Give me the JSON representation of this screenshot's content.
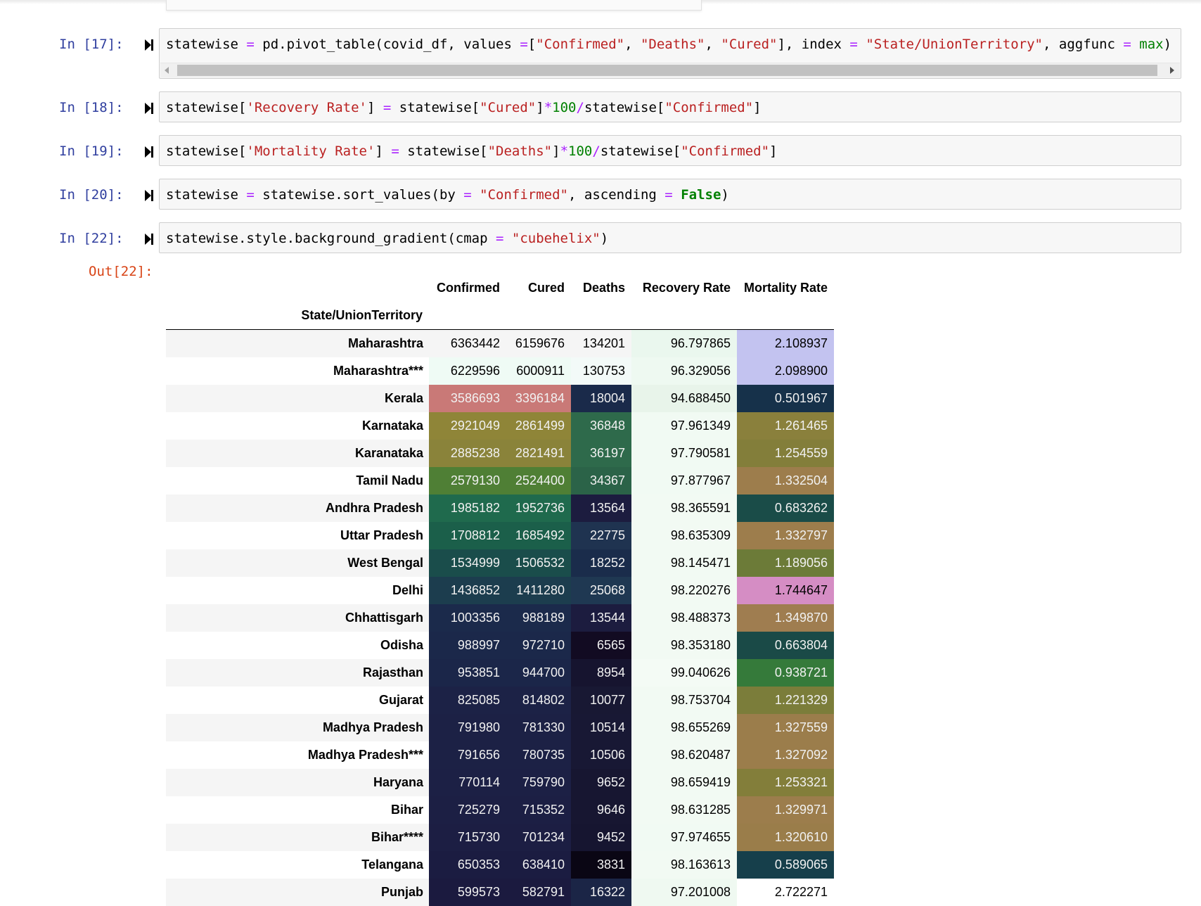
{
  "cells": [
    {
      "prompt": "In [17]:",
      "code_html": "statewise <span class=\"kw-op\">=</span> pd.pivot_table(covid_df, values <span class=\"kw-op\">=</span>[<span class=\"kw-str\">\"Confirmed\"</span>, <span class=\"kw-str\">\"Deaths\"</span>, <span class=\"kw-str\">\"Cured\"</span>], index <span class=\"kw-op\">=</span> <span class=\"kw-str\">\"State/UnionTerritory\"</span>, aggfunc <span class=\"kw-op\">=</span> <span class=\"kw-num\">max</span>)"
    },
    {
      "prompt": "In [18]:",
      "code_html": "statewise[<span class=\"kw-str\">'Recovery Rate'</span>] <span class=\"kw-op\">=</span> statewise[<span class=\"kw-str\">\"Cured\"</span>]<span class=\"kw-op\">*</span><span class=\"kw-num\">100</span><span class=\"kw-op\">/</span>statewise[<span class=\"kw-str\">\"Confirmed\"</span>]"
    },
    {
      "prompt": "In [19]:",
      "code_html": "statewise[<span class=\"kw-str\">'Mortality Rate'</span>] <span class=\"kw-op\">=</span> statewise[<span class=\"kw-str\">\"Deaths\"</span>]<span class=\"kw-op\">*</span><span class=\"kw-num\">100</span><span class=\"kw-op\">/</span>statewise[<span class=\"kw-str\">\"Confirmed\"</span>]"
    },
    {
      "prompt": "In [20]:",
      "code_html": "statewise <span class=\"kw-op\">=</span> statewise.sort_values(by <span class=\"kw-op\">=</span> <span class=\"kw-str\">\"Confirmed\"</span>, ascending <span class=\"kw-op\">=</span> <span class=\"kw-bool\">False</span>)"
    },
    {
      "prompt": "In [22]:",
      "code_html": "statewise.style.background_gradient(cmap <span class=\"kw-op\">=</span> <span class=\"kw-str\">\"cubehelix\"</span>)"
    }
  ],
  "output": {
    "prompt": "Out[22]:",
    "index_name": "State/UnionTerritory",
    "columns": [
      "Confirmed",
      "Cured",
      "Deaths",
      "Recovery Rate",
      "Mortality Rate"
    ],
    "rows": [
      {
        "state": "Maharashtra",
        "values": [
          "6363442",
          "6159676",
          "134201",
          "96.797865",
          "2.108937"
        ],
        "bg": [
          "#f5f5f5",
          "#f5f5f5",
          "#f5f5f5",
          "#eaf7ee",
          "#c3c3f0"
        ]
      },
      {
        "state": "Maharashtra***",
        "values": [
          "6229596",
          "6000911",
          "130753",
          "96.329056",
          "2.098900"
        ],
        "bg": [
          "#effbf5",
          "#effbf5",
          "#f3faf8",
          "#eef9f1",
          "#c3c3f0"
        ]
      },
      {
        "state": "Kerala",
        "values": [
          "3586693",
          "3396184",
          "18004",
          "94.688450",
          "0.501967"
        ],
        "bg": [
          "#c97977",
          "#c97977",
          "#1a2a4a",
          "#e8f4ea",
          "#16314a"
        ]
      },
      {
        "state": "Karnataka",
        "values": [
          "2921049",
          "2861499",
          "36848",
          "97.961349",
          "1.261465"
        ],
        "bg": [
          "#8f8538",
          "#8f8538",
          "#2e6a4b",
          "#f1faf3",
          "#8a803c"
        ]
      },
      {
        "state": "Karanataka",
        "values": [
          "2885238",
          "2821491",
          "36197",
          "97.790581",
          "1.254559"
        ],
        "bg": [
          "#8a833a",
          "#8a833a",
          "#2e6a4b",
          "#f1faf3",
          "#837e3a"
        ]
      },
      {
        "state": "Tamil Nadu",
        "values": [
          "2579130",
          "2524400",
          "34367",
          "97.877967",
          "1.332504"
        ],
        "bg": [
          "#4f7f35",
          "#4f7f35",
          "#2b6348",
          "#f1faf3",
          "#9d7d4c"
        ]
      },
      {
        "state": "Andhra Pradesh",
        "values": [
          "1985182",
          "1952736",
          "13564",
          "98.365591",
          "0.683262"
        ],
        "bg": [
          "#1f6a4d",
          "#1f6a4d",
          "#1c1c3f",
          "#f2faf3",
          "#1a4c48"
        ]
      },
      {
        "state": "Uttar Pradesh",
        "values": [
          "1708812",
          "1685492",
          "22775",
          "98.635309",
          "1.332797"
        ],
        "bg": [
          "#1b5f4a",
          "#1b5f4a",
          "#1f3350",
          "#f2faf3",
          "#9d7d4c"
        ]
      },
      {
        "state": "West Bengal",
        "values": [
          "1534999",
          "1506532",
          "18252",
          "98.145471",
          "1.189056"
        ],
        "bg": [
          "#1a4d4b",
          "#1a4d4b",
          "#1a2c4b",
          "#f2faf3",
          "#6c7b38"
        ]
      },
      {
        "state": "Delhi",
        "values": [
          "1436852",
          "1411280",
          "25068",
          "98.220276",
          "1.744647"
        ],
        "bg": [
          "#1c3d4e",
          "#1c3d4e",
          "#1f3852",
          "#f2faf3",
          "#d58dc4"
        ]
      },
      {
        "state": "Chhattisgarh",
        "values": [
          "1003356",
          "988189",
          "13544",
          "98.488373",
          "1.349870"
        ],
        "bg": [
          "#1b2a4b",
          "#1b2a4b",
          "#1c1c3f",
          "#f2faf3",
          "#9f7d50"
        ]
      },
      {
        "state": "Odisha",
        "values": [
          "988997",
          "972710",
          "6565",
          "98.353180",
          "0.663804"
        ],
        "bg": [
          "#1b284a",
          "#1b284a",
          "#120b22",
          "#f2faf3",
          "#1a4a47"
        ]
      },
      {
        "state": "Rajasthan",
        "values": [
          "953851",
          "944700",
          "8954",
          "99.040626",
          "0.938721"
        ],
        "bg": [
          "#1b2649",
          "#1b2649",
          "#16142f",
          "#f4fbf5",
          "#357a3a"
        ]
      },
      {
        "state": "Gujarat",
        "values": [
          "825085",
          "814802",
          "10077",
          "98.753704",
          "1.221329"
        ],
        "bg": [
          "#1c2246",
          "#1c2246",
          "#181833",
          "#f2faf3",
          "#7b7d3a"
        ]
      },
      {
        "state": "Madhya Pradesh",
        "values": [
          "791980",
          "781330",
          "10514",
          "98.655269",
          "1.327559"
        ],
        "bg": [
          "#1c2145",
          "#1c2145",
          "#181834",
          "#f2faf3",
          "#9b7d4b"
        ]
      },
      {
        "state": "Madhya Pradesh***",
        "values": [
          "791656",
          "780735",
          "10506",
          "98.620487",
          "1.327092"
        ],
        "bg": [
          "#1c2145",
          "#1c2145",
          "#181834",
          "#f2faf3",
          "#9b7d4b"
        ]
      },
      {
        "state": "Haryana",
        "values": [
          "770114",
          "759790",
          "9652",
          "98.659419",
          "1.253321"
        ],
        "bg": [
          "#1c2045",
          "#1c2045",
          "#171631",
          "#f2faf3",
          "#837e3a"
        ]
      },
      {
        "state": "Bihar",
        "values": [
          "725279",
          "715352",
          "9646",
          "98.631285",
          "1.329971"
        ],
        "bg": [
          "#1c1f44",
          "#1c1f44",
          "#171631",
          "#f2faf3",
          "#9c7d4c"
        ]
      },
      {
        "state": "Bihar****",
        "values": [
          "715730",
          "701234",
          "9452",
          "97.974655",
          "1.320610"
        ],
        "bg": [
          "#1c1e43",
          "#1c1e43",
          "#161530",
          "#f1faf3",
          "#9a7d4a"
        ]
      },
      {
        "state": "Telangana",
        "values": [
          "650353",
          "638410",
          "3831",
          "98.163613",
          "0.589065"
        ],
        "bg": [
          "#1b1c41",
          "#1b1c41",
          "#0a0614",
          "#f2faf3",
          "#163f4b"
        ]
      },
      {
        "state": "Punjab",
        "values": [
          "599573",
          "582791",
          "16322",
          "97.201008",
          "2.722271"
        ],
        "bg": [
          "#1b1a3f",
          "#1b1a3f",
          "#1b2546",
          "#eff9f1",
          "#ffffff"
        ]
      }
    ]
  }
}
